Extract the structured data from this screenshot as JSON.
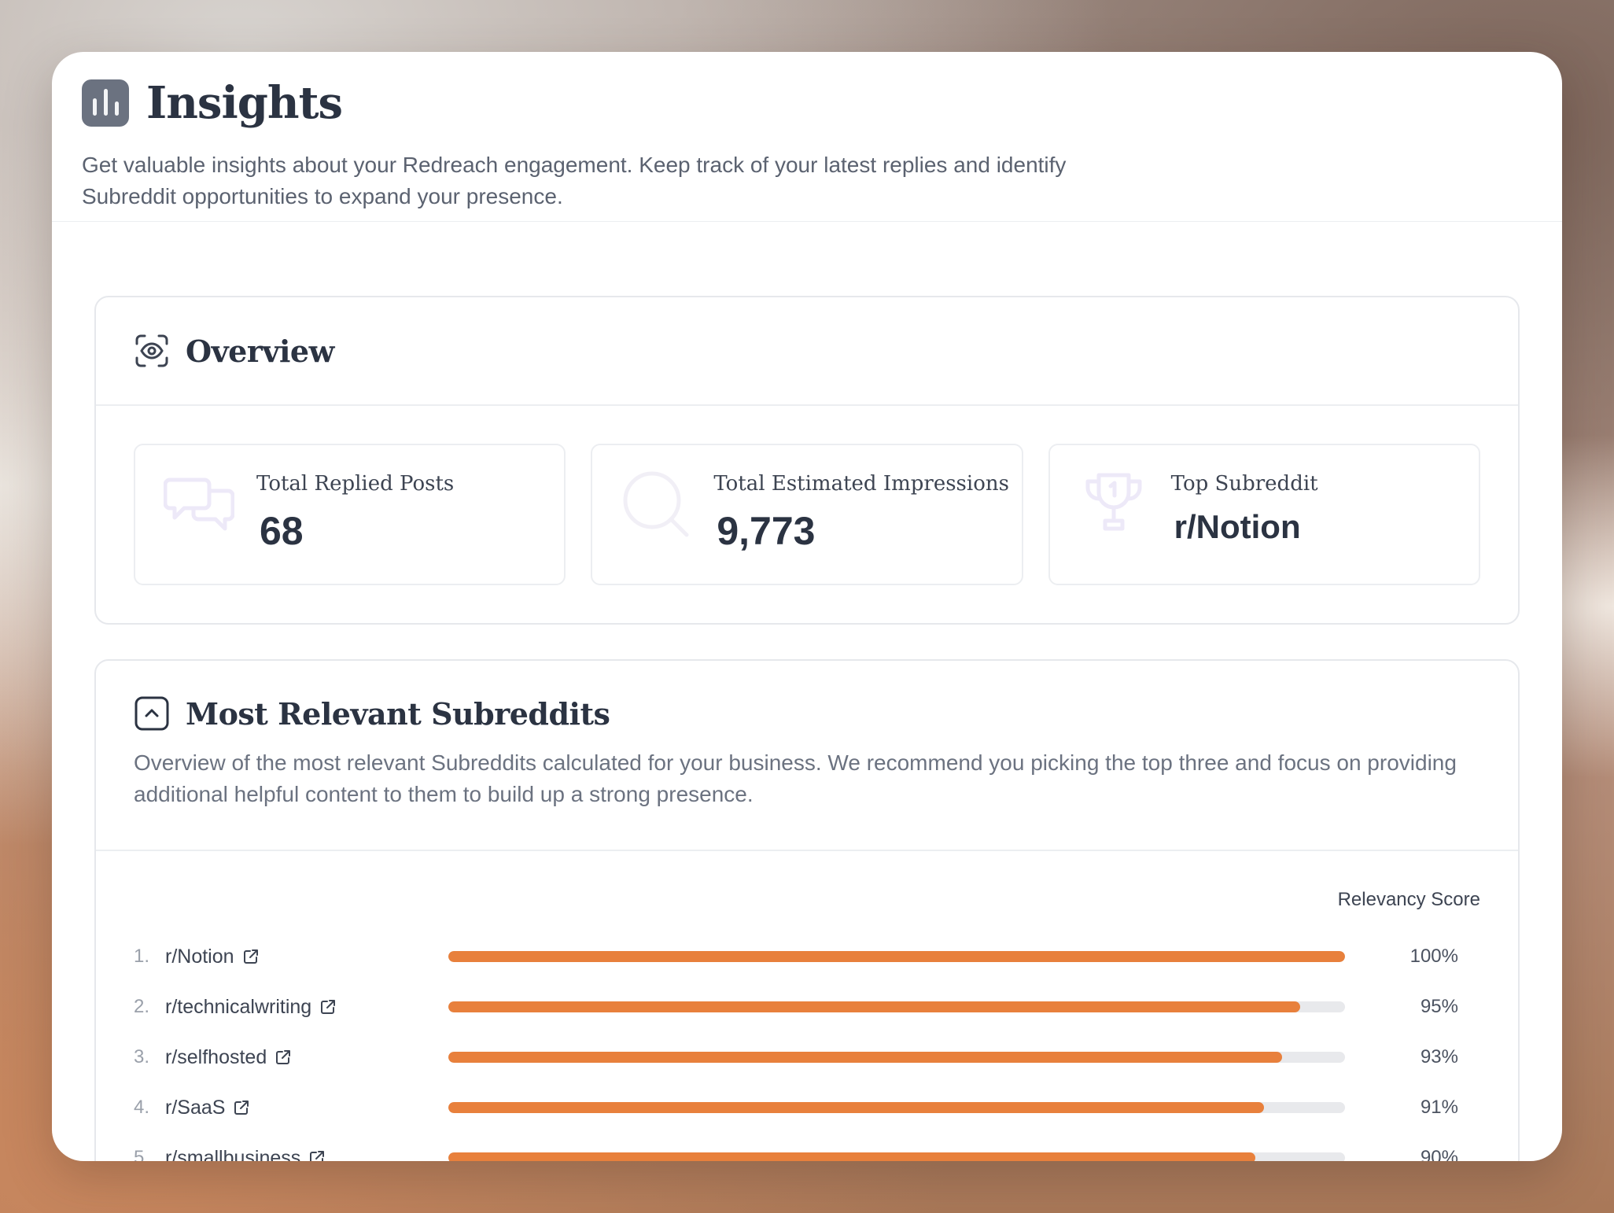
{
  "header": {
    "title": "Insights",
    "icon": "bar-chart-icon",
    "description": "Get valuable insights about your Redreach engagement. Keep track of your latest replies and identify Subreddit opportunities to expand your presence."
  },
  "overview": {
    "title": "Overview",
    "icon": "eye-icon",
    "stats": [
      {
        "label": "Total Replied Posts",
        "value": "68",
        "icon": "chat-bubbles-icon"
      },
      {
        "label": "Total Estimated Impressions",
        "value": "9,773",
        "icon": "search-icon"
      },
      {
        "label": "Top Subreddit",
        "value": "r/Notion",
        "icon": "trophy-icon"
      }
    ]
  },
  "relevant": {
    "title": "Most Relevant Subreddits",
    "icon": "chevron-up-icon",
    "description": "Overview of the most relevant Subreddits calculated for your business. We recommend you picking the top three and focus on providing additional helpful content to them to build up a strong presence.",
    "score_header": "Relevancy Score",
    "rows": [
      {
        "rank": "1.",
        "name": "r/Notion",
        "score": 100,
        "score_label": "100%"
      },
      {
        "rank": "2.",
        "name": "r/technicalwriting",
        "score": 95,
        "score_label": "95%"
      },
      {
        "rank": "3.",
        "name": "r/selfhosted",
        "score": 93,
        "score_label": "93%"
      },
      {
        "rank": "4.",
        "name": "r/SaaS",
        "score": 91,
        "score_label": "91%"
      },
      {
        "rank": "5.",
        "name": "r/smallbusiness",
        "score": 90,
        "score_label": "90%"
      }
    ]
  },
  "colors": {
    "accent": "#e8803c",
    "track": "#e8e9ec",
    "heading": "#2b3342",
    "icon_tint": "#ede9f7"
  }
}
